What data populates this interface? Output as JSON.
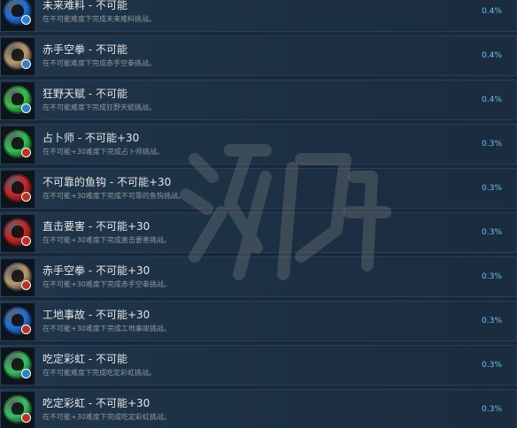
{
  "achievements": [
    {
      "title": "未来难料 - 不可能",
      "description": "在不可能难度下完成未来难料挑战。",
      "percent": "0.4%",
      "icon": "blue-medal-icon",
      "medal_color": "#1f6fd6",
      "badge_color": "#2f7fd0"
    },
    {
      "title": "赤手空拳 - 不可能",
      "description": "在不可能难度下完成赤手空拳挑战。",
      "percent": "0.4%",
      "icon": "fist-medal-icon",
      "medal_color": "#b89a72",
      "badge_color": "#2f7fd0"
    },
    {
      "title": "狂野天赋 - 不可能",
      "description": "在不可能难度下完成狂野天赋挑战。",
      "percent": "0.4%",
      "icon": "green-medal-icon",
      "medal_color": "#37c24a",
      "badge_color": "#2f7fd0"
    },
    {
      "title": "占卜师 - 不可能+30",
      "description": "在不可能+30难度下完成占卜师挑战。",
      "percent": "0.3%",
      "icon": "green-medal-icon",
      "medal_color": "#2fc14e",
      "badge_color": "#c03020"
    },
    {
      "title": "不可靠的鱼钩 - 不可能+30",
      "description": "在不可能+30难度下完成不可靠的鱼钩挑战。",
      "percent": "0.3%",
      "icon": "red-medal-icon",
      "medal_color": "#c42626",
      "badge_color": "#c03020"
    },
    {
      "title": "直击要害 - 不可能+30",
      "description": "在不可能+30难度下完成直击要害挑战。",
      "percent": "0.3%",
      "icon": "red-medal-icon",
      "medal_color": "#c42626",
      "badge_color": "#c03020"
    },
    {
      "title": "赤手空拳 - 不可能+30",
      "description": "在不可能+30难度下完成赤手空拳挑战。",
      "percent": "0.3%",
      "icon": "fist-medal-icon",
      "medal_color": "#b89a72",
      "badge_color": "#c03020"
    },
    {
      "title": "工地事故 - 不可能+30",
      "description": "在不可能+30难度下完成工地事故挑战。",
      "percent": "0.3%",
      "icon": "blue-medal-icon",
      "medal_color": "#1f6fd6",
      "badge_color": "#c03020"
    },
    {
      "title": "吃定彩虹 - 不可能",
      "description": "在不可能难度下完成吃定彩虹挑战。",
      "percent": "0.3%",
      "icon": "rainbow-medal-icon",
      "medal_color": "#38c060",
      "badge_color": "#2f7fd0"
    },
    {
      "title": "吃定彩虹 - 不可能+30",
      "description": "在不可能+30难度下完成吃定彩虹挑战。",
      "percent": "0.3%",
      "icon": "rainbow-medal-icon",
      "medal_color": "#38c060",
      "badge_color": "#c03020"
    }
  ],
  "watermark": {
    "icon": "youxiadan-watermark-icon"
  }
}
